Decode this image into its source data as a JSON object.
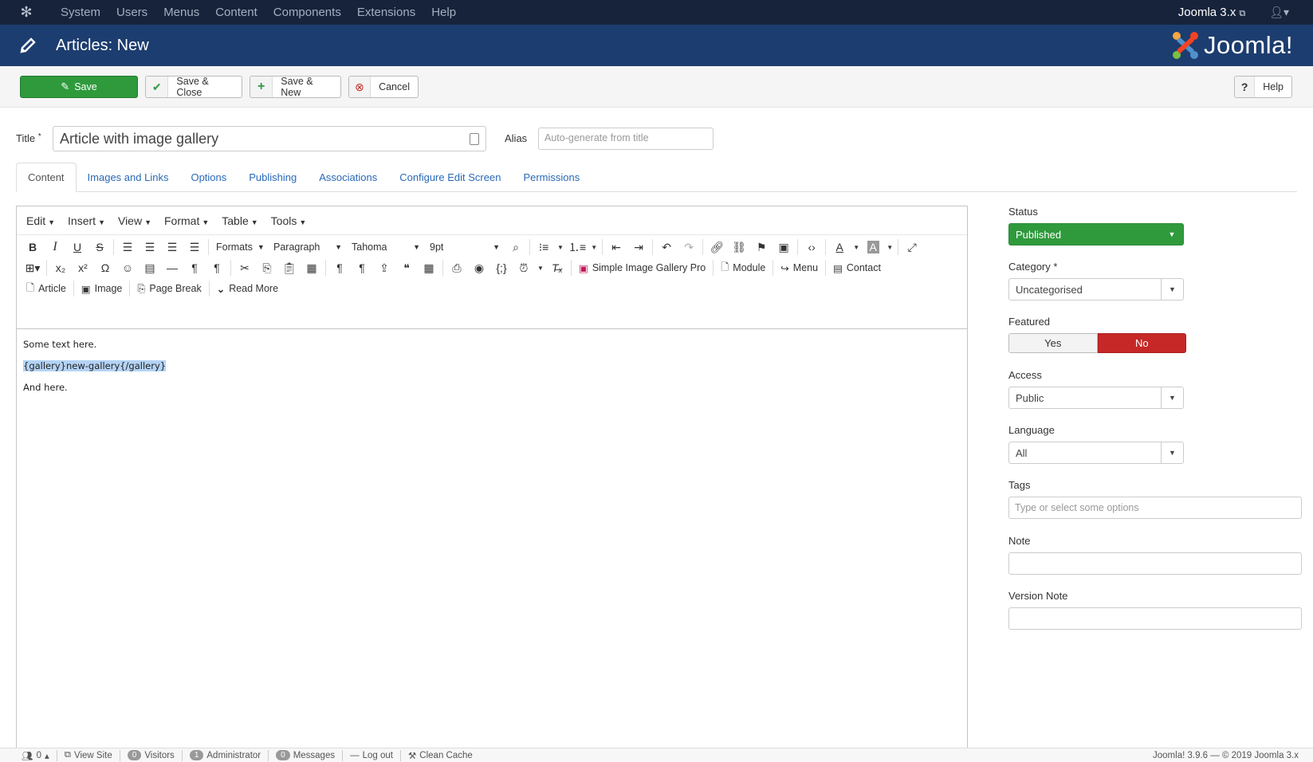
{
  "topnav": {
    "menu": [
      "System",
      "Users",
      "Menus",
      "Content",
      "Components",
      "Extensions",
      "Help"
    ],
    "site_link": "Joomla 3.x"
  },
  "titlebar": {
    "title": "Articles: New",
    "logo_text": "Joomla!"
  },
  "toolbar": {
    "save": "Save",
    "save_close": "Save & Close",
    "save_new": "Save & New",
    "cancel": "Cancel",
    "help": "Help"
  },
  "form": {
    "title_label": "Title",
    "title_required": "*",
    "title_value": "Article with image gallery",
    "alias_label": "Alias",
    "alias_placeholder": "Auto-generate from title"
  },
  "tabs": [
    "Content",
    "Images and Links",
    "Options",
    "Publishing",
    "Associations",
    "Configure Edit Screen",
    "Permissions"
  ],
  "editor": {
    "menubar": [
      "Edit",
      "Insert",
      "View",
      "Format",
      "Table",
      "Tools"
    ],
    "formats": "Formats",
    "block": "Paragraph",
    "font": "Tahoma",
    "size": "9pt",
    "plugin_buttons": {
      "gallery": "Simple Image Gallery Pro",
      "module": "Module",
      "menu": "Menu",
      "contact": "Contact",
      "article": "Article",
      "image": "Image",
      "page_break": "Page Break",
      "read_more": "Read More"
    },
    "content": {
      "line1": "Some text here.",
      "line2": "{gallery}new-gallery{/gallery}",
      "line3": "And here."
    }
  },
  "sidebar": {
    "status_label": "Status",
    "status_value": "Published",
    "category_label": "Category",
    "category_required": "*",
    "category_value": "Uncategorised",
    "featured_label": "Featured",
    "featured_yes": "Yes",
    "featured_no": "No",
    "access_label": "Access",
    "access_value": "Public",
    "language_label": "Language",
    "language_value": "All",
    "tags_label": "Tags",
    "tags_placeholder": "Type or select some options",
    "note_label": "Note",
    "version_note_label": "Version Note"
  },
  "statusbar": {
    "toggle_count": "0",
    "view_site": "View Site",
    "visitors_count": "0",
    "visitors": "Visitors",
    "admin_count": "1",
    "admin": "Administrator",
    "messages_count": "0",
    "messages": "Messages",
    "logout": "Log out",
    "clean_cache": "Clean Cache",
    "version": "Joomla! 3.9.6  —  © 2019 Joomla 3.x"
  },
  "colors": {
    "topnav_bg": "#17233b",
    "titlebar_bg": "#1c3d6f",
    "save_green": "#2f9a3c",
    "no_red": "#c52827",
    "link_blue": "#2a69b8"
  }
}
